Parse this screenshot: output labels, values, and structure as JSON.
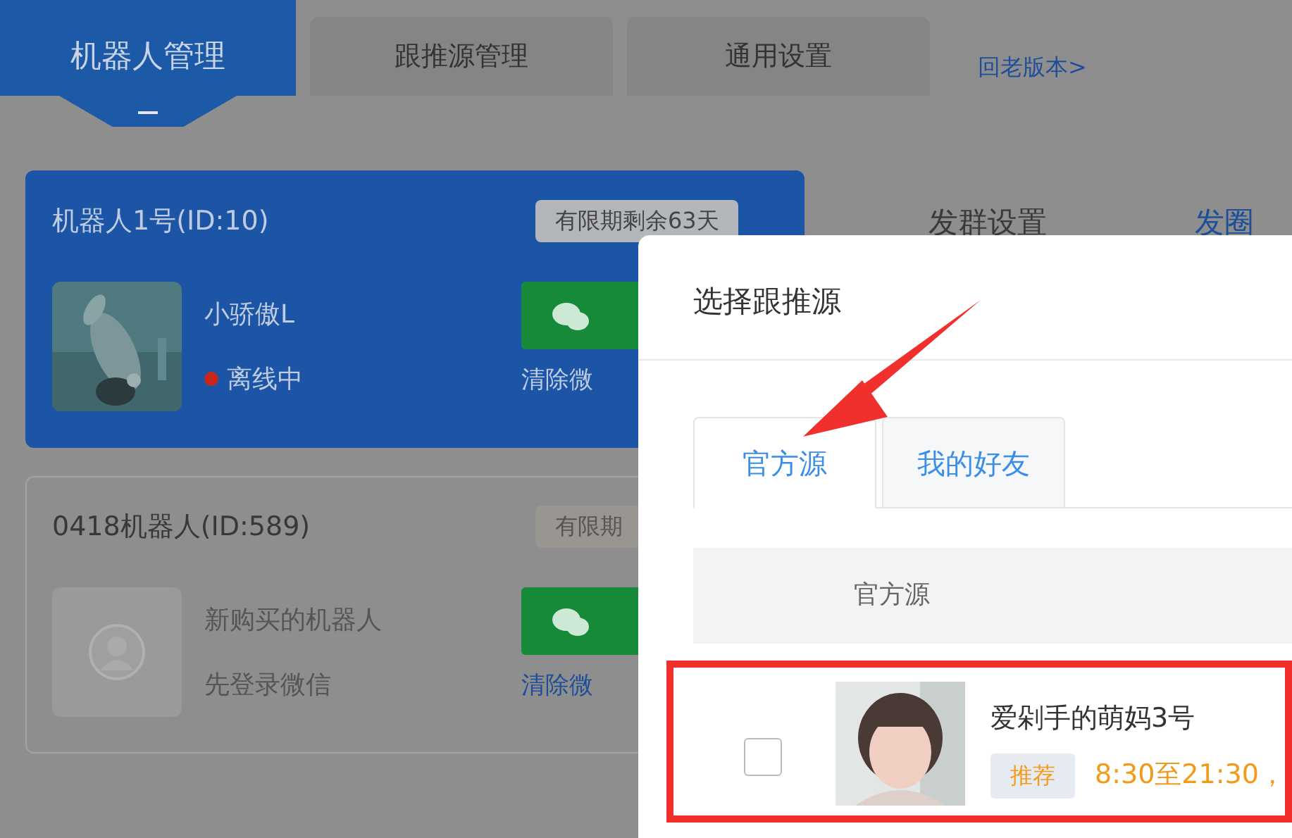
{
  "top_tabs": [
    {
      "label": "机器人管理",
      "selected": true
    },
    {
      "label": "跟推源管理",
      "selected": false
    },
    {
      "label": "通用设置",
      "selected": false
    }
  ],
  "old_version_link": "回老版本>",
  "robots": [
    {
      "title": "机器人1号(ID:10)",
      "expiry": "有限期剩余63天",
      "selected": true,
      "avatar": {
        "kind": "picture"
      },
      "lines": [
        {
          "kind": "name",
          "text": "小骄傲L"
        },
        {
          "kind": "status",
          "text": "离线中"
        }
      ],
      "clear_link": "清除微"
    },
    {
      "title": "0418机器人(ID:589)",
      "expiry": "有限期",
      "selected": false,
      "avatar": {
        "kind": "placeholder"
      },
      "lines": [
        {
          "kind": "name",
          "text": "新购买的机器人"
        },
        {
          "kind": "name",
          "text": "先登录微信"
        }
      ],
      "clear_link": "清除微"
    }
  ],
  "right_tabs": [
    {
      "label": "发群设置",
      "selected": false
    },
    {
      "label": "发圈",
      "selected": true
    }
  ],
  "modal": {
    "title": "选择跟推源",
    "tabs": [
      {
        "label": "官方源",
        "selected": true
      },
      {
        "label": "我的好友",
        "selected": false
      }
    ],
    "table": {
      "columns": [
        "官方源"
      ],
      "rows": [
        {
          "checked": false,
          "highlighted": true,
          "avatar": {
            "kind": "picture"
          },
          "name": "爱剁手的萌妈3号",
          "tag": "推荐",
          "schedule": "8:30至21:30，"
        }
      ]
    }
  }
}
